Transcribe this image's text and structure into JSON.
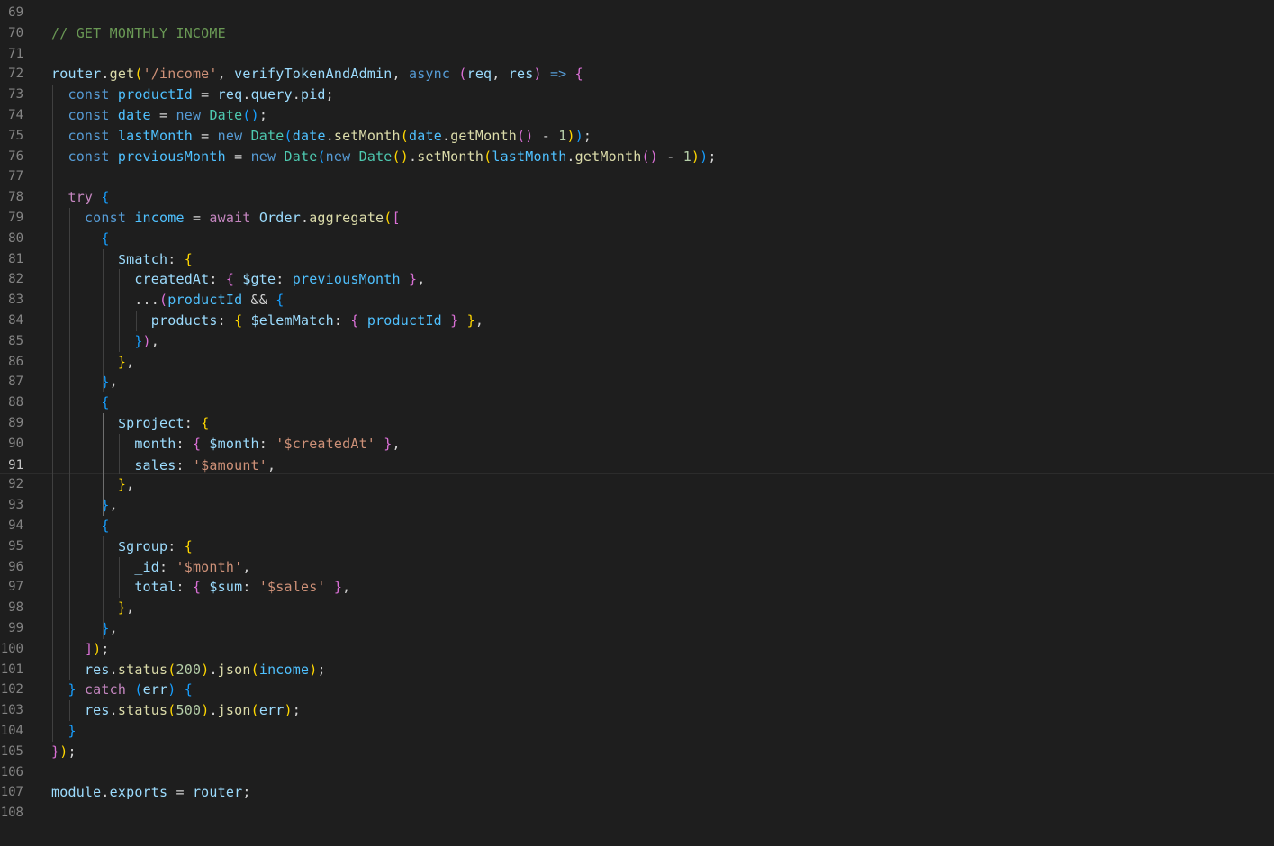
{
  "editor": {
    "language": "javascript",
    "current_line": 91,
    "first_visible_line": 69,
    "lines": [
      {
        "n": "69",
        "tokens": []
      },
      {
        "n": "70",
        "tokens": [
          [
            "cm",
            "// GET MONTHLY INCOME"
          ]
        ]
      },
      {
        "n": "71",
        "tokens": []
      },
      {
        "n": "72",
        "tokens": [
          [
            "var",
            "router"
          ],
          [
            "pl",
            "."
          ],
          [
            "fn",
            "get"
          ],
          [
            "b1",
            "("
          ],
          [
            "str",
            "'/income'"
          ],
          [
            "pl",
            ", "
          ],
          [
            "var",
            "verifyTokenAndAdmin"
          ],
          [
            "pl",
            ", "
          ],
          [
            "kw",
            "async"
          ],
          [
            "pl",
            " "
          ],
          [
            "b2",
            "("
          ],
          [
            "var",
            "req"
          ],
          [
            "pl",
            ", "
          ],
          [
            "var",
            "res"
          ],
          [
            "b2",
            ")"
          ],
          [
            "pl",
            " "
          ],
          [
            "kw",
            "=>"
          ],
          [
            "pl",
            " "
          ],
          [
            "b2",
            "{"
          ]
        ]
      },
      {
        "n": "73",
        "tokens": [
          [
            "pl",
            "  "
          ],
          [
            "kw",
            "const"
          ],
          [
            "pl",
            " "
          ],
          [
            "cst",
            "productId"
          ],
          [
            "pl",
            " = "
          ],
          [
            "var",
            "req"
          ],
          [
            "pl",
            "."
          ],
          [
            "var",
            "query"
          ],
          [
            "pl",
            "."
          ],
          [
            "var",
            "pid"
          ],
          [
            "pl",
            ";"
          ]
        ]
      },
      {
        "n": "74",
        "tokens": [
          [
            "pl",
            "  "
          ],
          [
            "kw",
            "const"
          ],
          [
            "pl",
            " "
          ],
          [
            "cst",
            "date"
          ],
          [
            "pl",
            " = "
          ],
          [
            "kw",
            "new"
          ],
          [
            "pl",
            " "
          ],
          [
            "cls",
            "Date"
          ],
          [
            "b3",
            "("
          ],
          [
            "b3",
            ")"
          ],
          [
            "pl",
            ";"
          ]
        ]
      },
      {
        "n": "75",
        "tokens": [
          [
            "pl",
            "  "
          ],
          [
            "kw",
            "const"
          ],
          [
            "pl",
            " "
          ],
          [
            "cst",
            "lastMonth"
          ],
          [
            "pl",
            " = "
          ],
          [
            "kw",
            "new"
          ],
          [
            "pl",
            " "
          ],
          [
            "cls",
            "Date"
          ],
          [
            "b3",
            "("
          ],
          [
            "cst",
            "date"
          ],
          [
            "pl",
            "."
          ],
          [
            "fn",
            "setMonth"
          ],
          [
            "b1",
            "("
          ],
          [
            "cst",
            "date"
          ],
          [
            "pl",
            "."
          ],
          [
            "fn",
            "getMonth"
          ],
          [
            "b2",
            "("
          ],
          [
            "b2",
            ")"
          ],
          [
            "pl",
            " - "
          ],
          [
            "num",
            "1"
          ],
          [
            "b1",
            ")"
          ],
          [
            "b3",
            ")"
          ],
          [
            "pl",
            ";"
          ]
        ]
      },
      {
        "n": "76",
        "tokens": [
          [
            "pl",
            "  "
          ],
          [
            "kw",
            "const"
          ],
          [
            "pl",
            " "
          ],
          [
            "cst",
            "previousMonth"
          ],
          [
            "pl",
            " = "
          ],
          [
            "kw",
            "new"
          ],
          [
            "pl",
            " "
          ],
          [
            "cls",
            "Date"
          ],
          [
            "b3",
            "("
          ],
          [
            "kw",
            "new"
          ],
          [
            "pl",
            " "
          ],
          [
            "cls",
            "Date"
          ],
          [
            "b1",
            "("
          ],
          [
            "b1",
            ")"
          ],
          [
            "pl",
            "."
          ],
          [
            "fn",
            "setMonth"
          ],
          [
            "b1",
            "("
          ],
          [
            "cst",
            "lastMonth"
          ],
          [
            "pl",
            "."
          ],
          [
            "fn",
            "getMonth"
          ],
          [
            "b2",
            "("
          ],
          [
            "b2",
            ")"
          ],
          [
            "pl",
            " - "
          ],
          [
            "num",
            "1"
          ],
          [
            "b1",
            ")"
          ],
          [
            "b3",
            ")"
          ],
          [
            "pl",
            ";"
          ]
        ]
      },
      {
        "n": "77",
        "tokens": []
      },
      {
        "n": "78",
        "tokens": [
          [
            "pl",
            "  "
          ],
          [
            "ctl",
            "try"
          ],
          [
            "pl",
            " "
          ],
          [
            "b3",
            "{"
          ]
        ]
      },
      {
        "n": "79",
        "tokens": [
          [
            "pl",
            "    "
          ],
          [
            "kw",
            "const"
          ],
          [
            "pl",
            " "
          ],
          [
            "cst",
            "income"
          ],
          [
            "pl",
            " = "
          ],
          [
            "ctl",
            "await"
          ],
          [
            "pl",
            " "
          ],
          [
            "var",
            "Order"
          ],
          [
            "pl",
            "."
          ],
          [
            "fn",
            "aggregate"
          ],
          [
            "b1",
            "("
          ],
          [
            "b2",
            "["
          ]
        ]
      },
      {
        "n": "80",
        "tokens": [
          [
            "pl",
            "      "
          ],
          [
            "b3",
            "{"
          ]
        ]
      },
      {
        "n": "81",
        "tokens": [
          [
            "pl",
            "        "
          ],
          [
            "var",
            "$match"
          ],
          [
            "pl",
            ": "
          ],
          [
            "b1",
            "{"
          ]
        ]
      },
      {
        "n": "82",
        "tokens": [
          [
            "pl",
            "          "
          ],
          [
            "var",
            "createdAt"
          ],
          [
            "pl",
            ": "
          ],
          [
            "b2",
            "{"
          ],
          [
            "pl",
            " "
          ],
          [
            "var",
            "$gte"
          ],
          [
            "pl",
            ": "
          ],
          [
            "cst",
            "previousMonth"
          ],
          [
            "pl",
            " "
          ],
          [
            "b2",
            "}"
          ],
          [
            "pl",
            ","
          ]
        ]
      },
      {
        "n": "83",
        "tokens": [
          [
            "pl",
            "          ..."
          ],
          [
            "b2",
            "("
          ],
          [
            "cst",
            "productId"
          ],
          [
            "pl",
            " && "
          ],
          [
            "b3",
            "{"
          ]
        ]
      },
      {
        "n": "84",
        "tokens": [
          [
            "pl",
            "            "
          ],
          [
            "var",
            "products"
          ],
          [
            "pl",
            ": "
          ],
          [
            "b1",
            "{"
          ],
          [
            "pl",
            " "
          ],
          [
            "var",
            "$elemMatch"
          ],
          [
            "pl",
            ": "
          ],
          [
            "b2",
            "{"
          ],
          [
            "pl",
            " "
          ],
          [
            "cst",
            "productId"
          ],
          [
            "pl",
            " "
          ],
          [
            "b2",
            "}"
          ],
          [
            "pl",
            " "
          ],
          [
            "b1",
            "}"
          ],
          [
            "pl",
            ","
          ]
        ]
      },
      {
        "n": "85",
        "tokens": [
          [
            "pl",
            "          "
          ],
          [
            "b3",
            "}"
          ],
          [
            "b2",
            ")"
          ],
          [
            "pl",
            ","
          ]
        ]
      },
      {
        "n": "86",
        "tokens": [
          [
            "pl",
            "        "
          ],
          [
            "b1",
            "}"
          ],
          [
            "pl",
            ","
          ]
        ]
      },
      {
        "n": "87",
        "tokens": [
          [
            "pl",
            "      "
          ],
          [
            "b3",
            "}"
          ],
          [
            "pl",
            ","
          ]
        ]
      },
      {
        "n": "88",
        "tokens": [
          [
            "pl",
            "      "
          ],
          [
            "b3",
            "{"
          ]
        ]
      },
      {
        "n": "89",
        "tokens": [
          [
            "pl",
            "        "
          ],
          [
            "var",
            "$project"
          ],
          [
            "pl",
            ": "
          ],
          [
            "b1",
            "{"
          ]
        ]
      },
      {
        "n": "90",
        "tokens": [
          [
            "pl",
            "          "
          ],
          [
            "var",
            "month"
          ],
          [
            "pl",
            ": "
          ],
          [
            "b2",
            "{"
          ],
          [
            "pl",
            " "
          ],
          [
            "var",
            "$month"
          ],
          [
            "pl",
            ": "
          ],
          [
            "str",
            "'$createdAt'"
          ],
          [
            "pl",
            " "
          ],
          [
            "b2",
            "}"
          ],
          [
            "pl",
            ","
          ]
        ]
      },
      {
        "n": "91",
        "tokens": [
          [
            "pl",
            "          "
          ],
          [
            "var",
            "sales"
          ],
          [
            "pl",
            ": "
          ],
          [
            "str",
            "'$amount'"
          ],
          [
            "pl",
            ","
          ]
        ]
      },
      {
        "n": "92",
        "tokens": [
          [
            "pl",
            "        "
          ],
          [
            "b1",
            "}"
          ],
          [
            "pl",
            ","
          ]
        ]
      },
      {
        "n": "93",
        "tokens": [
          [
            "pl",
            "      "
          ],
          [
            "b3",
            "}"
          ],
          [
            "pl",
            ","
          ]
        ]
      },
      {
        "n": "94",
        "tokens": [
          [
            "pl",
            "      "
          ],
          [
            "b3",
            "{"
          ]
        ]
      },
      {
        "n": "95",
        "tokens": [
          [
            "pl",
            "        "
          ],
          [
            "var",
            "$group"
          ],
          [
            "pl",
            ": "
          ],
          [
            "b1",
            "{"
          ]
        ]
      },
      {
        "n": "96",
        "tokens": [
          [
            "pl",
            "          "
          ],
          [
            "var",
            "_id"
          ],
          [
            "pl",
            ": "
          ],
          [
            "str",
            "'$month'"
          ],
          [
            "pl",
            ","
          ]
        ]
      },
      {
        "n": "97",
        "tokens": [
          [
            "pl",
            "          "
          ],
          [
            "var",
            "total"
          ],
          [
            "pl",
            ": "
          ],
          [
            "b2",
            "{"
          ],
          [
            "pl",
            " "
          ],
          [
            "var",
            "$sum"
          ],
          [
            "pl",
            ": "
          ],
          [
            "str",
            "'$sales'"
          ],
          [
            "pl",
            " "
          ],
          [
            "b2",
            "}"
          ],
          [
            "pl",
            ","
          ]
        ]
      },
      {
        "n": "98",
        "tokens": [
          [
            "pl",
            "        "
          ],
          [
            "b1",
            "}"
          ],
          [
            "pl",
            ","
          ]
        ]
      },
      {
        "n": "99",
        "tokens": [
          [
            "pl",
            "      "
          ],
          [
            "b3",
            "}"
          ],
          [
            "pl",
            ","
          ]
        ]
      },
      {
        "n": "100",
        "tokens": [
          [
            "pl",
            "    "
          ],
          [
            "b2",
            "]"
          ],
          [
            "b1",
            ")"
          ],
          [
            "pl",
            ";"
          ]
        ]
      },
      {
        "n": "101",
        "tokens": [
          [
            "pl",
            "    "
          ],
          [
            "var",
            "res"
          ],
          [
            "pl",
            "."
          ],
          [
            "fn",
            "status"
          ],
          [
            "b1",
            "("
          ],
          [
            "num",
            "200"
          ],
          [
            "b1",
            ")"
          ],
          [
            "pl",
            "."
          ],
          [
            "fn",
            "json"
          ],
          [
            "b1",
            "("
          ],
          [
            "cst",
            "income"
          ],
          [
            "b1",
            ")"
          ],
          [
            "pl",
            ";"
          ]
        ]
      },
      {
        "n": "102",
        "tokens": [
          [
            "pl",
            "  "
          ],
          [
            "b3",
            "}"
          ],
          [
            "pl",
            " "
          ],
          [
            "ctl",
            "catch"
          ],
          [
            "pl",
            " "
          ],
          [
            "b3",
            "("
          ],
          [
            "var",
            "err"
          ],
          [
            "b3",
            ")"
          ],
          [
            "pl",
            " "
          ],
          [
            "b3",
            "{"
          ]
        ]
      },
      {
        "n": "103",
        "tokens": [
          [
            "pl",
            "    "
          ],
          [
            "var",
            "res"
          ],
          [
            "pl",
            "."
          ],
          [
            "fn",
            "status"
          ],
          [
            "b1",
            "("
          ],
          [
            "num",
            "500"
          ],
          [
            "b1",
            ")"
          ],
          [
            "pl",
            "."
          ],
          [
            "fn",
            "json"
          ],
          [
            "b1",
            "("
          ],
          [
            "var",
            "err"
          ],
          [
            "b1",
            ")"
          ],
          [
            "pl",
            ";"
          ]
        ]
      },
      {
        "n": "104",
        "tokens": [
          [
            "pl",
            "  "
          ],
          [
            "b3",
            "}"
          ]
        ]
      },
      {
        "n": "105",
        "tokens": [
          [
            "b2",
            "}"
          ],
          [
            "b1",
            ")"
          ],
          [
            "pl",
            ";"
          ]
        ]
      },
      {
        "n": "106",
        "tokens": []
      },
      {
        "n": "107",
        "tokens": [
          [
            "var",
            "module"
          ],
          [
            "pl",
            "."
          ],
          [
            "var",
            "exports"
          ],
          [
            "pl",
            " = "
          ],
          [
            "var",
            "router"
          ],
          [
            "pl",
            ";"
          ]
        ]
      },
      {
        "n": "108",
        "tokens": []
      }
    ]
  },
  "colors": {
    "background": "#1e1e1e",
    "line_number": "#858585",
    "comment": "#6a9955",
    "keyword": "#569cd6",
    "control": "#c586c0",
    "function": "#dcdcaa",
    "string": "#ce9178",
    "number": "#b5cea8",
    "variable": "#9cdcfe",
    "constant": "#4fc1ff",
    "class": "#4ec9b0"
  }
}
